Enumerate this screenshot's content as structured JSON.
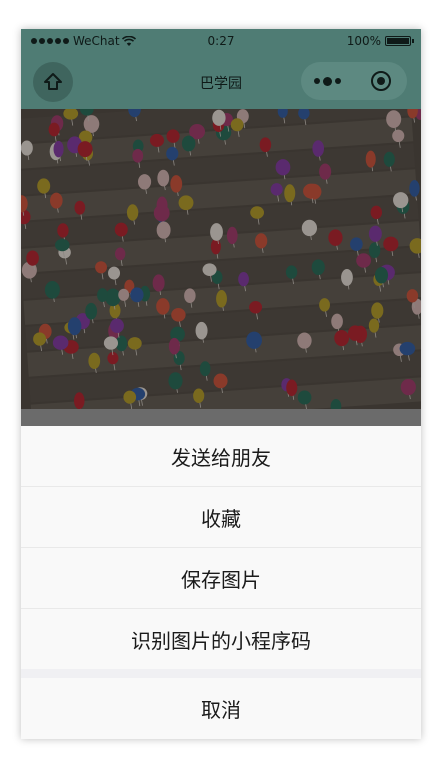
{
  "status_bar": {
    "carrier": "WeChat",
    "time": "0:27",
    "battery": "100%"
  },
  "nav_bar": {
    "title": "巴学园",
    "icons": [
      "home-icon",
      "more-icon",
      "close-target-icon"
    ]
  },
  "photo": {
    "description_icon": "pins-photo"
  },
  "action_sheet": {
    "items": [
      {
        "label": "发送给朋友"
      },
      {
        "label": "收藏"
      },
      {
        "label": "保存图片"
      },
      {
        "label": "识别图片的小程序码"
      }
    ],
    "cancel_label": "取消"
  },
  "colors": {
    "nav_bg": "#4f7c74",
    "overlay": "#6b6b6b",
    "sheet_bg": "#f9f9f9"
  }
}
